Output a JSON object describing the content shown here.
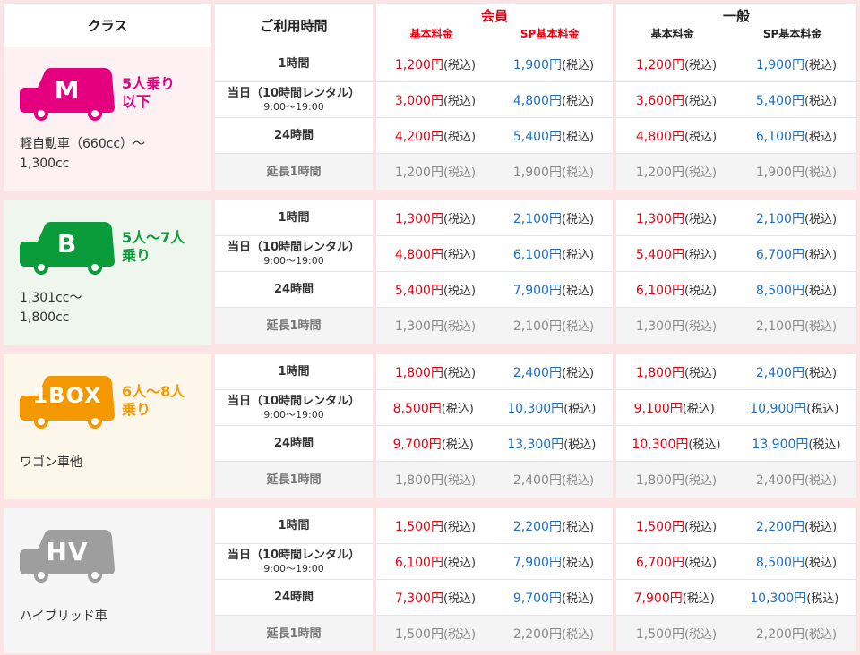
{
  "header": {
    "class_label": "クラス",
    "time_label": "ご利用時間",
    "member": {
      "title": "会員",
      "base": "基本料金",
      "sp": "SP基本料金"
    },
    "general": {
      "title": "一般",
      "base": "基本料金",
      "sp": "SP基本料金"
    }
  },
  "colors": {
    "member_price": "#e60012",
    "sp_price": "#1a6fc4",
    "M": "#e4007f",
    "B": "#0a9b3a",
    "1BOX": "#f39800",
    "HV": "#9e9e9e"
  },
  "tax": "(税込)",
  "time_labels": {
    "h1": "1時間",
    "day": "当日（10時間レンタル）",
    "day_sub": "9:00〜19:00",
    "h24": "24時間",
    "ext": "延長1時間"
  },
  "sections": [
    {
      "key": "M",
      "badge": "M",
      "capacity": "5人乗り\n以下",
      "cc": "軽自動車（660cc）〜\n1,300cc",
      "prices": [
        [
          "1,200円",
          "1,900円",
          "1,200円",
          "1,900円"
        ],
        [
          "3,000円",
          "4,800円",
          "3,600円",
          "5,400円"
        ],
        [
          "4,200円",
          "5,400円",
          "4,800円",
          "6,100円"
        ],
        [
          "1,200円",
          "1,900円",
          "1,200円",
          "1,900円"
        ]
      ]
    },
    {
      "key": "B",
      "badge": "B",
      "capacity": "5人〜7人\n乗り",
      "cc": "1,301cc〜\n1,800cc",
      "prices": [
        [
          "1,300円",
          "2,100円",
          "1,300円",
          "2,100円"
        ],
        [
          "4,800円",
          "6,100円",
          "5,400円",
          "6,700円"
        ],
        [
          "5,400円",
          "7,900円",
          "6,100円",
          "8,500円"
        ],
        [
          "1,300円",
          "2,100円",
          "1,300円",
          "2,100円"
        ]
      ]
    },
    {
      "key": "1BOX",
      "badge": "1BOX",
      "capacity": "6人〜8人\n乗り",
      "cc": "ワゴン車他",
      "prices": [
        [
          "1,800円",
          "2,400円",
          "1,800円",
          "2,400円"
        ],
        [
          "8,500円",
          "10,300円",
          "9,100円",
          "10,900円"
        ],
        [
          "9,700円",
          "13,300円",
          "10,300円",
          "13,900円"
        ],
        [
          "1,800円",
          "2,400円",
          "1,800円",
          "2,400円"
        ]
      ]
    },
    {
      "key": "HV",
      "badge": "HV",
      "capacity": "",
      "cc": "ハイブリッド車",
      "prices": [
        [
          "1,500円",
          "2,200円",
          "1,500円",
          "2,200円"
        ],
        [
          "6,100円",
          "7,900円",
          "6,700円",
          "8,500円"
        ],
        [
          "7,300円",
          "9,700円",
          "7,900円",
          "10,300円"
        ],
        [
          "1,500円",
          "2,200円",
          "1,500円",
          "2,200円"
        ]
      ]
    }
  ]
}
